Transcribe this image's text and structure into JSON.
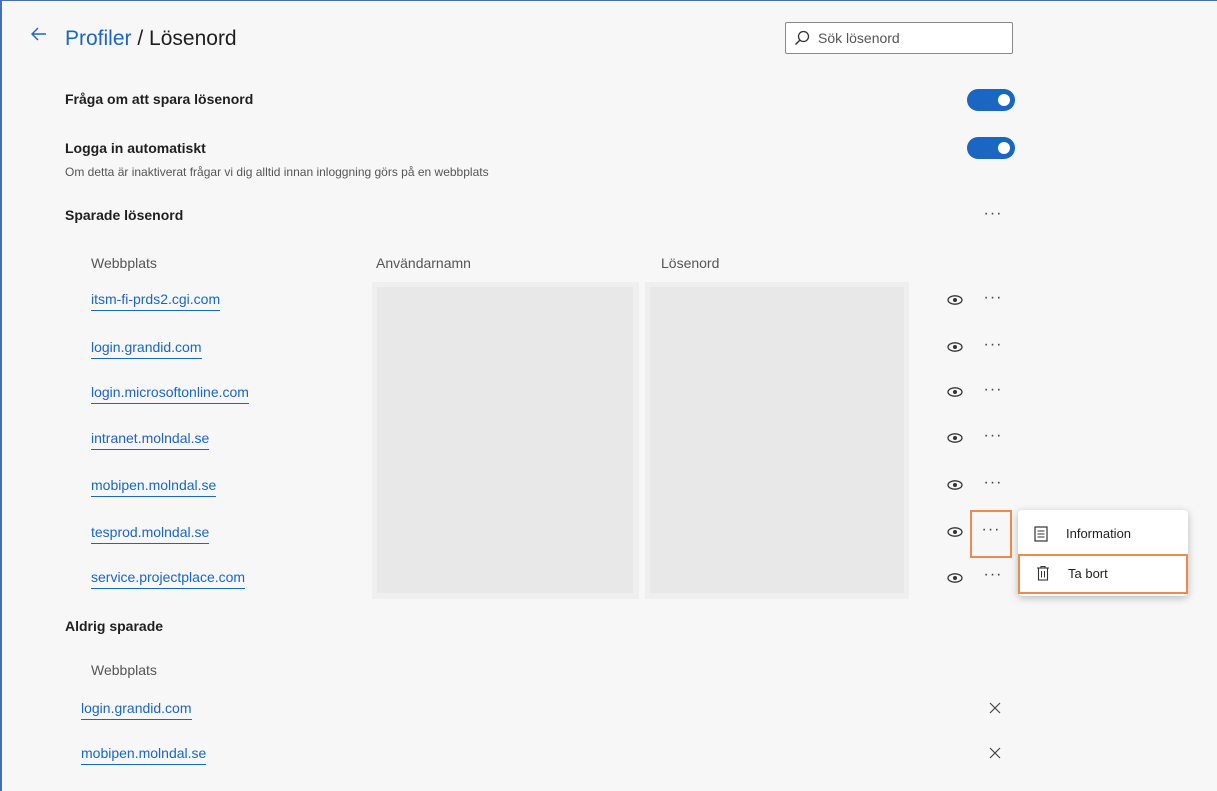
{
  "header": {
    "breadcrumb_parent": "Profiler",
    "breadcrumb_separator": " / ",
    "breadcrumb_current": "Lösenord",
    "search_placeholder": "Sök lösenord",
    "search_value": ""
  },
  "settings": {
    "offer_save": {
      "label": "Fråga om att spara lösenord",
      "enabled": true
    },
    "auto_signin": {
      "label": "Logga in automatiskt",
      "description": "Om detta är inaktiverat frågar vi dig alltid innan inloggning görs på en webbplats",
      "enabled": true
    }
  },
  "saved": {
    "title": "Sparade lösenord",
    "columns": {
      "site": "Webbplats",
      "username": "Användarnamn",
      "password": "Lösenord"
    },
    "rows": [
      {
        "site": "itsm-fi-prds2.cgi.com"
      },
      {
        "site": "login.grandid.com"
      },
      {
        "site": "login.microsoftonline.com"
      },
      {
        "site": "intranet.molndal.se"
      },
      {
        "site": "mobipen.molndal.se"
      },
      {
        "site": "tesprod.molndal.se"
      },
      {
        "site": "service.projectplace.com"
      }
    ]
  },
  "never_saved": {
    "title": "Aldrig sparade",
    "column_site": "Webbplats",
    "rows": [
      {
        "site": "login.grandid.com"
      },
      {
        "site": "mobipen.molndal.se"
      }
    ]
  },
  "context_menu": {
    "items": [
      {
        "label": "Information",
        "icon": "details-icon"
      },
      {
        "label": "Ta bort",
        "icon": "trash-icon"
      }
    ]
  },
  "more_glyph": "···",
  "colors": {
    "accent": "#1a66c2",
    "highlight": "#f08a4b",
    "frame": "#4a6fb0"
  }
}
